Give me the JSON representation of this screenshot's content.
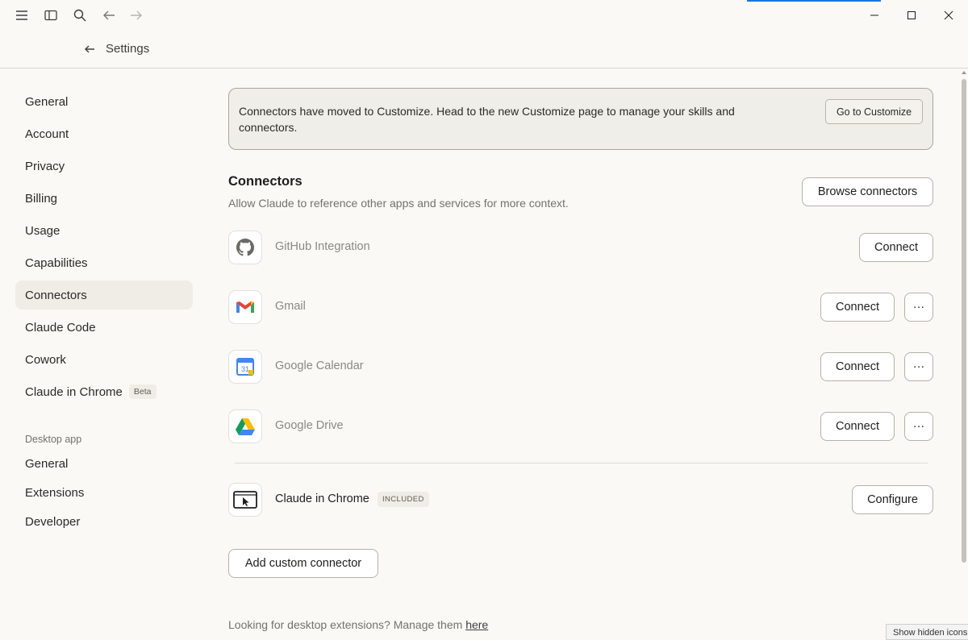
{
  "header": {
    "back_label": "Settings"
  },
  "sidebar": {
    "items": [
      {
        "label": "General"
      },
      {
        "label": "Account"
      },
      {
        "label": "Privacy"
      },
      {
        "label": "Billing"
      },
      {
        "label": "Usage"
      },
      {
        "label": "Capabilities"
      },
      {
        "label": "Connectors",
        "active": true
      },
      {
        "label": "Claude Code"
      },
      {
        "label": "Cowork"
      },
      {
        "label": "Claude in Chrome",
        "badge": "Beta"
      }
    ],
    "desktop_section": {
      "title": "Desktop app",
      "items": [
        {
          "label": "General"
        },
        {
          "label": "Extensions"
        },
        {
          "label": "Developer"
        }
      ]
    }
  },
  "notice": {
    "text": "Connectors have moved to Customize. Head to the new Customize page to manage your skills and connectors.",
    "button": "Go to Customize"
  },
  "connectors": {
    "title": "Connectors",
    "description": "Allow Claude to reference other apps and services for more context.",
    "browse_button": "Browse connectors",
    "items": [
      {
        "name": "GitHub Integration",
        "icon": "github-icon",
        "action": "Connect"
      },
      {
        "name": "Gmail",
        "icon": "gmail-icon",
        "action": "Connect",
        "more": "···"
      },
      {
        "name": "Google Calendar",
        "icon": "google-calendar-icon",
        "action": "Connect",
        "more": "···"
      },
      {
        "name": "Google Drive",
        "icon": "google-drive-icon",
        "action": "Connect",
        "more": "···"
      }
    ],
    "chrome": {
      "name": "Claude in Chrome",
      "badge": "INCLUDED",
      "action": "Configure"
    },
    "add_custom": "Add custom connector",
    "footer_prefix": "Looking for desktop extensions? Manage them ",
    "footer_link": "here"
  },
  "tooltip": "Show hidden icons",
  "calendar_day": "31"
}
